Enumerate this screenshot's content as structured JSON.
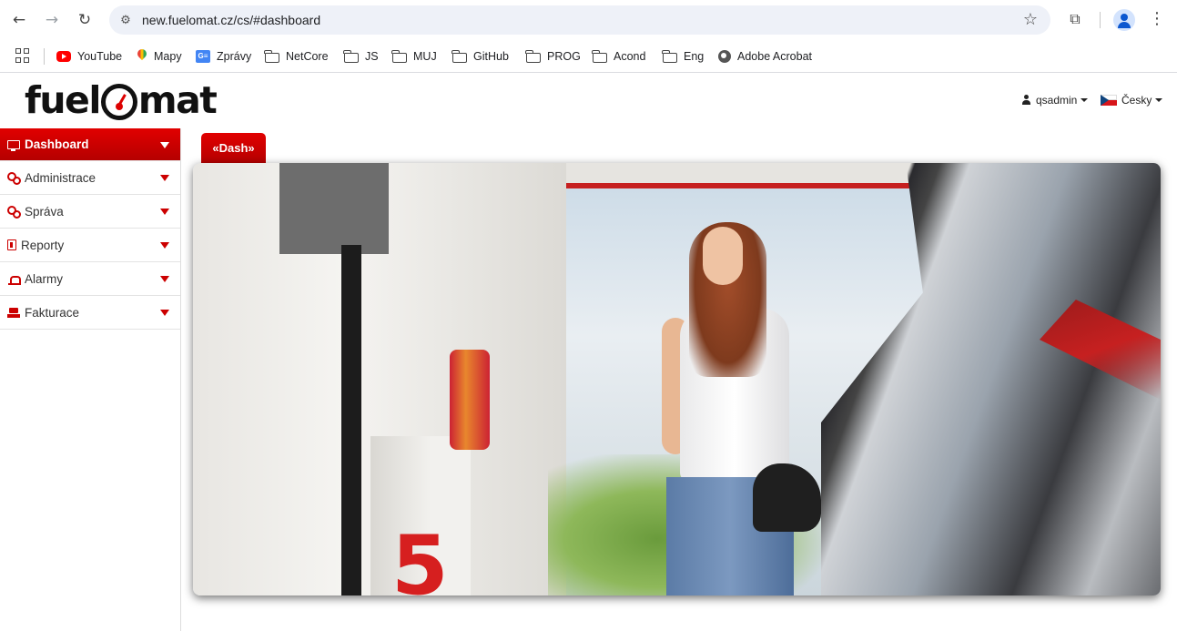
{
  "browser": {
    "url": "new.fuelomat.cz/cs/#dashboard",
    "bookmarks": [
      "YouTube",
      "Mapy",
      "Zprávy",
      "NetCore",
      "JS",
      "MUJ",
      "GitHub",
      "PROG",
      "Acond",
      "Eng",
      "Adobe Acrobat"
    ]
  },
  "app": {
    "logo": {
      "left": "fuel",
      "right": "mat"
    },
    "user": "qsadmin",
    "language": "Česky",
    "sidebar": [
      {
        "label": "Dashboard",
        "icon": "monitor-icon",
        "active": true
      },
      {
        "label": "Administrace",
        "icon": "gears-icon"
      },
      {
        "label": "Správa",
        "icon": "gears-icon"
      },
      {
        "label": "Reporty",
        "icon": "report-icon"
      },
      {
        "label": "Alarmy",
        "icon": "alarm-icon"
      },
      {
        "label": "Fakturace",
        "icon": "invoice-icon"
      }
    ],
    "tab_label": "«Dash»",
    "hero_number": "5",
    "colors": {
      "accent": "#d40000",
      "accent_dark": "#b50000"
    }
  }
}
